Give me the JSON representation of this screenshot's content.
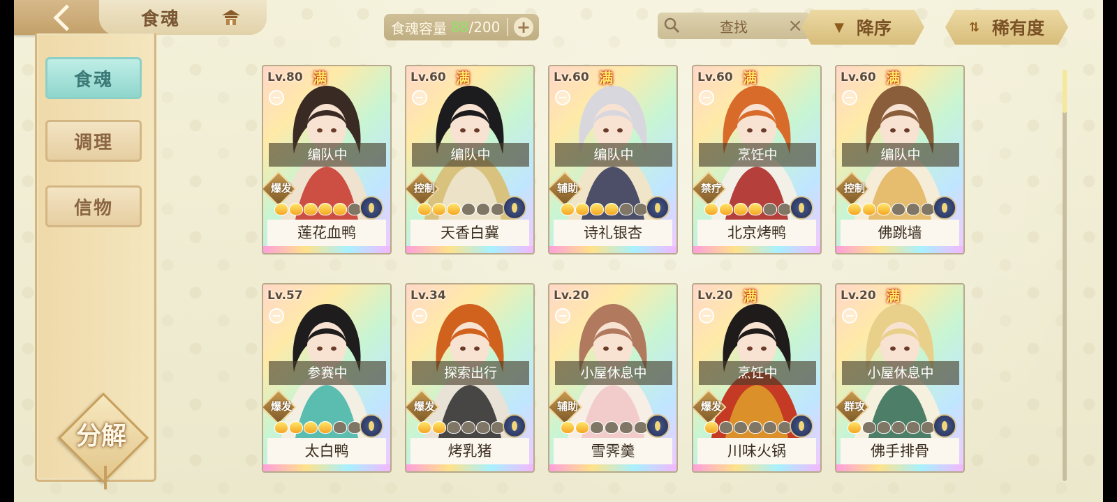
{
  "header": {
    "title": "食魂",
    "capacity_label": "食魂容量",
    "capacity_used": "88",
    "capacity_total": "/200",
    "search_placeholder": "查找",
    "sort_order_label": "降序",
    "sort_field_label": "稀有度"
  },
  "sidebar": {
    "tabs": [
      {
        "label": "食魂",
        "active": true
      },
      {
        "label": "调理",
        "active": false
      },
      {
        "label": "信物",
        "active": false
      }
    ],
    "decompose_label": "分解"
  },
  "colors": {
    "accent_teal": "#8fd6cd",
    "capacity_green": "#8fe36a",
    "full_badge": "#ffea6a"
  },
  "cards": [
    {
      "level": "Lv.80",
      "full_badge": "满",
      "status": "编队中",
      "role": "爆发",
      "stars_lit": 5,
      "name": "莲花血鸭",
      "art": "long dark hair warrior with red/white robes"
    },
    {
      "level": "Lv.60",
      "full_badge": "满",
      "status": "编队中",
      "role": "控制",
      "stars_lit": 3,
      "name": "天香白冀",
      "art": "long black hair in white robes"
    },
    {
      "level": "Lv.60",
      "full_badge": "满",
      "status": "编队中",
      "role": "辅助",
      "stars_lit": 4,
      "name": "诗礼银杏",
      "art": "silver-haired girl in dark outfit"
    },
    {
      "level": "Lv.60",
      "full_badge": "满",
      "status": "烹饪中",
      "role": "禁疗",
      "stars_lit": 4,
      "name": "北京烤鸭",
      "art": "orange-haired character with umbrella"
    },
    {
      "level": "Lv.60",
      "full_badge": "满",
      "status": "编队中",
      "role": "控制",
      "stars_lit": 3,
      "name": "佛跳墙",
      "art": "long brown-haired figure in gold robes"
    },
    {
      "level": "Lv.57",
      "full_badge": "",
      "status": "参赛中",
      "role": "爆发",
      "stars_lit": 4,
      "name": "太白鸭",
      "art": "dark-haired swordsman with teal scarf"
    },
    {
      "level": "Lv.34",
      "full_badge": "",
      "status": "探索出行",
      "role": "爆发",
      "stars_lit": 2,
      "name": "烤乳猪",
      "art": "masked warrior with fiery hair"
    },
    {
      "level": "Lv.20",
      "full_badge": "",
      "status": "小屋休息中",
      "role": "辅助",
      "stars_lit": 2,
      "name": "雪霁羹",
      "art": "soft-haired girl in pink kimono"
    },
    {
      "level": "Lv.20",
      "full_badge": "满",
      "status": "烹饪中",
      "role": "爆发",
      "stars_lit": 1,
      "name": "川味火锅",
      "art": "dark-haired youth with flames"
    },
    {
      "level": "Lv.20",
      "full_badge": "满",
      "status": "小屋休息中",
      "role": "群攻",
      "stars_lit": 1,
      "name": "佛手排骨",
      "art": "blonde youth in green outfit"
    }
  ]
}
